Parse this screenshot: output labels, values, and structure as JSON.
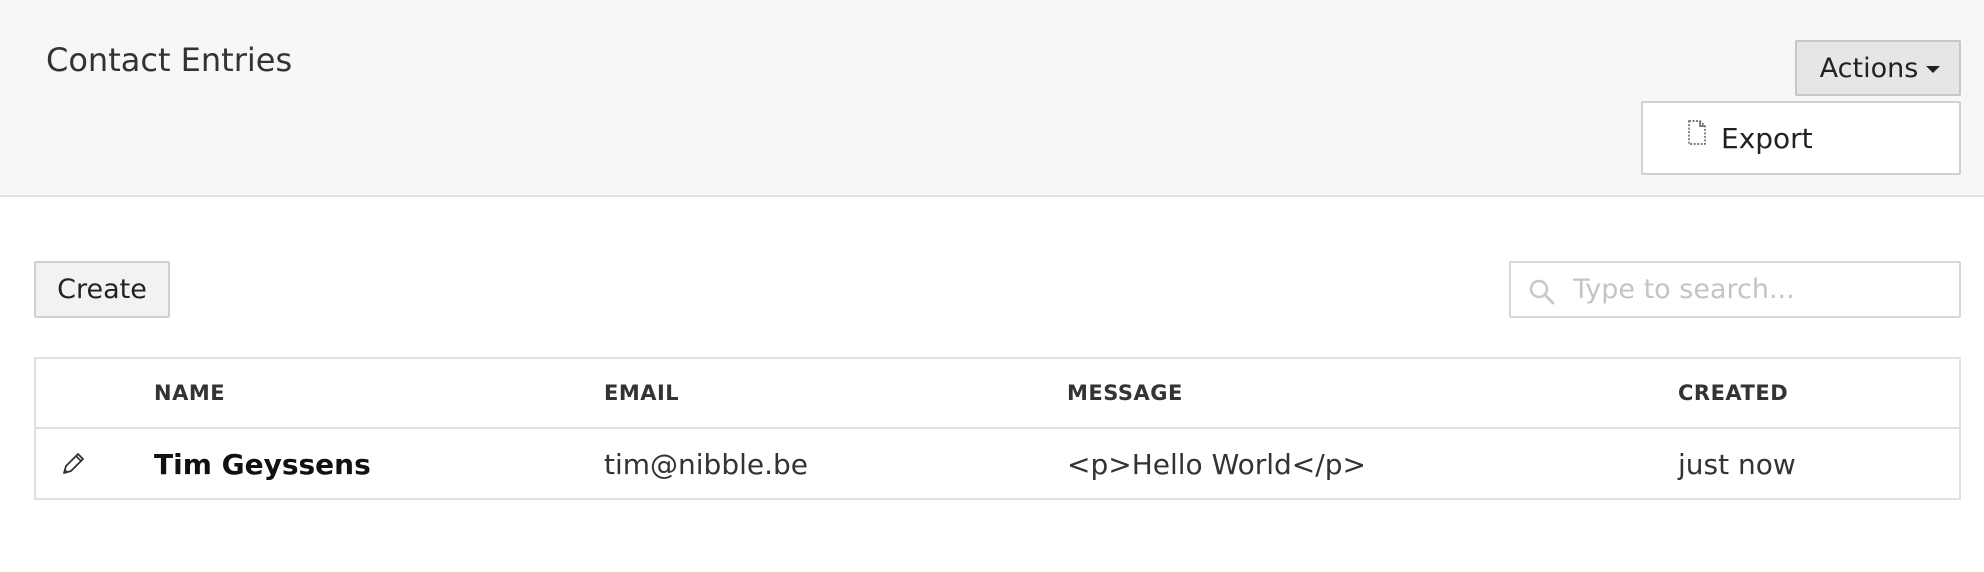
{
  "header": {
    "title": "Contact Entries",
    "actions_label": "Actions",
    "dropdown": {
      "items": [
        {
          "label": "Export",
          "icon": "document-icon"
        }
      ]
    }
  },
  "toolbar": {
    "create_label": "Create",
    "search": {
      "placeholder": "Type to search...",
      "value": "",
      "icon": "search-icon"
    }
  },
  "table": {
    "columns": [
      "NAME",
      "EMAIL",
      "MESSAGE",
      "CREATED"
    ],
    "rows": [
      {
        "edit_icon": "pencil-icon",
        "name": "Tim Geyssens",
        "email": "tim@nibble.be",
        "message": "<p>Hello World</p>",
        "created": "just now"
      }
    ]
  },
  "colors": {
    "header_bg": "#f7f7f7",
    "button_bg": "#e6e6e6",
    "border": "#e1e1e1",
    "placeholder": "#c4c4c4"
  }
}
